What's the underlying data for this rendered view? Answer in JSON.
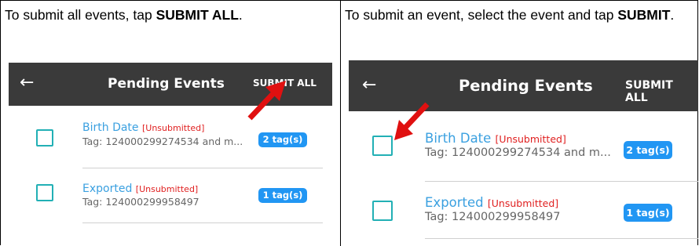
{
  "left_panel": {
    "caption_text": "To submit all events, tap ",
    "caption_bold": "SUBMIT ALL",
    "caption_end": ".",
    "app_bar": {
      "back_icon": "←",
      "title": "Pending Events",
      "action": "SUBMIT ALL"
    },
    "events": [
      {
        "title": "Birth Date",
        "status": "[Unsubmitted]",
        "tag": "Tag: 124000299274534 and m...",
        "badge": "2 tag(s)"
      },
      {
        "title": "Exported",
        "status": "[Unsubmitted]",
        "tag": "Tag: 124000299958497",
        "badge": "1 tag(s)"
      }
    ]
  },
  "right_panel": {
    "caption_text": "To submit an event, select the event and tap ",
    "caption_bold": "SUBMIT",
    "caption_end": ".",
    "app_bar": {
      "back_icon": "←",
      "title": "Pending Events",
      "action": "SUBMIT ALL"
    },
    "events": [
      {
        "title": "Birth Date",
        "status": "[Unsubmitted]",
        "tag": "Tag: 124000299274534 and m...",
        "badge": "2 tag(s)"
      },
      {
        "title": "Exported",
        "status": "[Unsubmitted]",
        "tag": "Tag: 124000299958497",
        "badge": "1 tag(s)"
      }
    ]
  },
  "colors": {
    "app_bar": "#3a3a3a",
    "checkbox": "#22b0b5",
    "link": "#3aa0e0",
    "status": "#e02020",
    "badge": "#2196f3",
    "arrow": "#e01010"
  }
}
